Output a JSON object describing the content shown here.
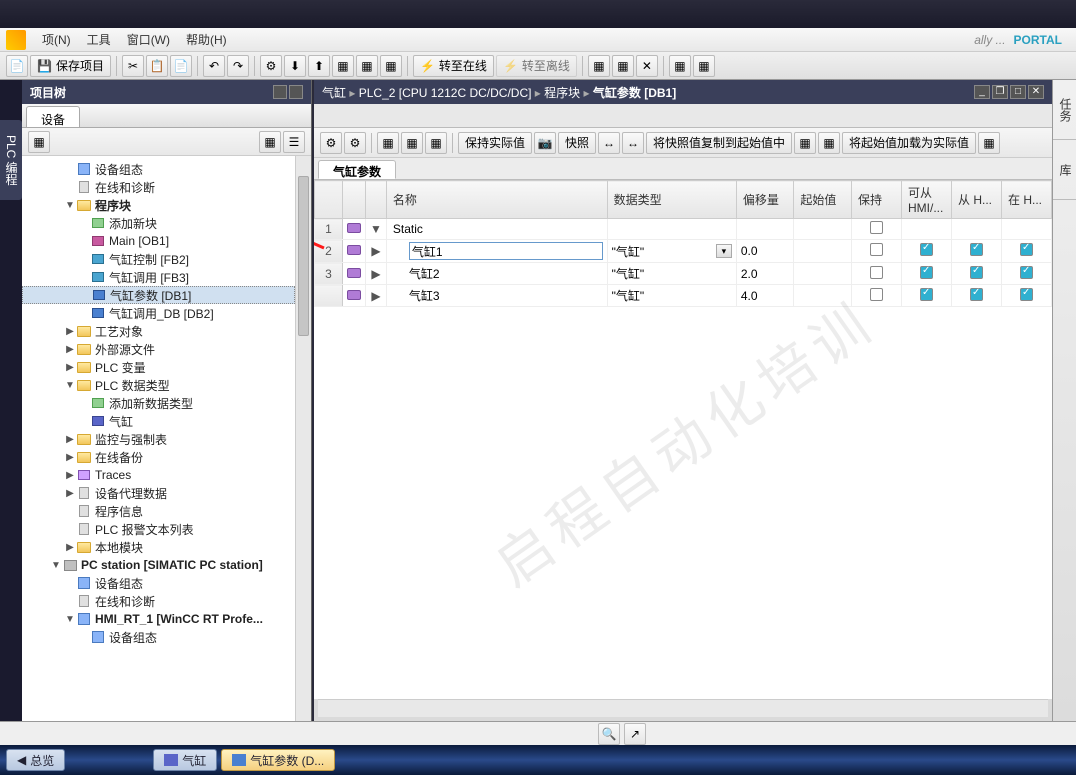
{
  "menubar": {
    "items": [
      "项(N)",
      "工具",
      "窗口(W)",
      "帮助(H)"
    ],
    "right_brand": "PORTAL",
    "right_text": "ally ..."
  },
  "main_toolbar": {
    "save_label": "保存项目",
    "go_online": "转至在线",
    "go_offline": "转至离线"
  },
  "project_tree": {
    "title": "项目树",
    "device_tab": "设备",
    "nodes_flat": [
      {
        "d": 3,
        "exp": " ",
        "icon": "ico-device",
        "label": "设备组态"
      },
      {
        "d": 3,
        "exp": " ",
        "icon": "ico-file",
        "label": "在线和诊断"
      },
      {
        "d": 3,
        "exp": "▼",
        "icon": "ico-folder",
        "label": "程序块",
        "bold": true
      },
      {
        "d": 4,
        "exp": " ",
        "icon": "ico-add",
        "label": "添加新块"
      },
      {
        "d": 4,
        "exp": " ",
        "icon": "ico-ob",
        "label": "Main [OB1]"
      },
      {
        "d": 4,
        "exp": " ",
        "icon": "ico-fb",
        "label": "气缸控制 [FB2]"
      },
      {
        "d": 4,
        "exp": " ",
        "icon": "ico-fb",
        "label": "气缸调用 [FB3]"
      },
      {
        "d": 4,
        "exp": " ",
        "icon": "ico-db",
        "label": "气缸参数 [DB1]",
        "selected": true
      },
      {
        "d": 4,
        "exp": " ",
        "icon": "ico-db",
        "label": "气缸调用_DB [DB2]"
      },
      {
        "d": 3,
        "exp": "▶",
        "icon": "ico-folder",
        "label": "工艺对象"
      },
      {
        "d": 3,
        "exp": "▶",
        "icon": "ico-folder",
        "label": "外部源文件"
      },
      {
        "d": 3,
        "exp": "▶",
        "icon": "ico-folder",
        "label": "PLC 变量"
      },
      {
        "d": 3,
        "exp": "▼",
        "icon": "ico-folder",
        "label": "PLC 数据类型"
      },
      {
        "d": 4,
        "exp": " ",
        "icon": "ico-add",
        "label": "添加新数据类型"
      },
      {
        "d": 4,
        "exp": " ",
        "icon": "ico-block",
        "label": "气缸"
      },
      {
        "d": 3,
        "exp": "▶",
        "icon": "ico-folder",
        "label": "监控与强制表"
      },
      {
        "d": 3,
        "exp": "▶",
        "icon": "ico-folder",
        "label": "在线备份"
      },
      {
        "d": 3,
        "exp": "▶",
        "icon": "ico-trace",
        "label": "Traces"
      },
      {
        "d": 3,
        "exp": "▶",
        "icon": "ico-file",
        "label": "设备代理数据"
      },
      {
        "d": 3,
        "exp": " ",
        "icon": "ico-file",
        "label": "程序信息"
      },
      {
        "d": 3,
        "exp": " ",
        "icon": "ico-file",
        "label": "PLC 报警文本列表"
      },
      {
        "d": 3,
        "exp": "▶",
        "icon": "ico-folder",
        "label": "本地模块"
      },
      {
        "d": 2,
        "exp": "▼",
        "icon": "ico-pc",
        "label": "PC station [SIMATIC PC station]",
        "bold": true
      },
      {
        "d": 3,
        "exp": " ",
        "icon": "ico-device",
        "label": "设备组态"
      },
      {
        "d": 3,
        "exp": " ",
        "icon": "ico-file",
        "label": "在线和诊断"
      },
      {
        "d": 3,
        "exp": "▼",
        "icon": "ico-device",
        "label": "HMI_RT_1 [WinCC RT Profe...",
        "bold": true
      },
      {
        "d": 4,
        "exp": " ",
        "icon": "ico-device",
        "label": "设备组态"
      }
    ]
  },
  "editor": {
    "breadcrumb": [
      "气缸",
      "PLC_2 [CPU 1212C DC/DC/DC]",
      "程序块",
      "气缸参数 [DB1]"
    ],
    "toolbar": {
      "keep_actual": "保持实际值",
      "snapshot": "快照",
      "copy_snapshot": "将快照值复制到起始值中",
      "load_start": "将起始值加载为实际值"
    },
    "tab_label": "气缸参数",
    "columns": [
      "名称",
      "数据类型",
      "偏移量",
      "起始值",
      "保持",
      "可从 HMI/...",
      "从 H...",
      "在 H..."
    ],
    "rows": [
      {
        "num": "1",
        "lvl": 0,
        "exp": "▼",
        "name": "Static",
        "type": "",
        "offset": "",
        "start": "",
        "retain": false,
        "hmi1": null,
        "hmi2": null,
        "hmi3": null
      },
      {
        "num": "2",
        "lvl": 1,
        "exp": "▶",
        "name": "气缸1",
        "type": "\"气缸\"",
        "offset": "0.0",
        "start": "",
        "retain": false,
        "hmi1": true,
        "hmi2": true,
        "hmi3": true,
        "sel": true,
        "combo": true
      },
      {
        "num": "3",
        "lvl": 1,
        "exp": "▶",
        "name": "气缸2",
        "type": "\"气缸\"",
        "offset": "2.0",
        "start": "",
        "retain": false,
        "hmi1": true,
        "hmi2": true,
        "hmi3": true
      },
      {
        "num": "",
        "lvl": 1,
        "exp": "▶",
        "name": "气缸3",
        "type": "\"气缸\"",
        "offset": "4.0",
        "start": "",
        "retain": false,
        "hmi1": true,
        "hmi2": true,
        "hmi3": true
      }
    ],
    "watermark": "启程自动化培训"
  },
  "right_tabs": [
    "任务",
    "库"
  ],
  "taskbar": {
    "overview": "总览",
    "tab1": "气缸",
    "tab2": "气缸参数 (D..."
  },
  "sidebar_label": "PLC 编程"
}
